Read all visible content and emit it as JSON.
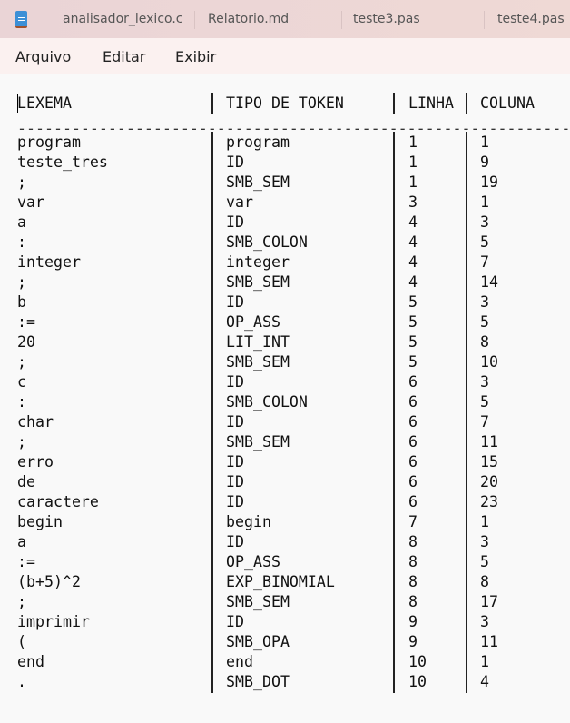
{
  "tabs": [
    {
      "label": "analisador_lexico.c"
    },
    {
      "label": "Relatorio.md"
    },
    {
      "label": "teste3.pas"
    },
    {
      "label": "teste4.pas"
    }
  ],
  "menu": {
    "file": "Arquivo",
    "edit": "Editar",
    "view": "Exibir"
  },
  "table": {
    "headers": [
      "LEXEMA",
      "TIPO DE TOKEN",
      "LINHA",
      "COLUNA"
    ],
    "separator": "--------------------------------------------------------------",
    "rows": [
      [
        "program",
        "program",
        "1",
        "1"
      ],
      [
        "teste_tres",
        "ID",
        "1",
        "9"
      ],
      [
        ";",
        "SMB_SEM",
        "1",
        "19"
      ],
      [
        "var",
        "var",
        "3",
        "1"
      ],
      [
        "a",
        "ID",
        "4",
        "3"
      ],
      [
        ":",
        "SMB_COLON",
        "4",
        "5"
      ],
      [
        "integer",
        "integer",
        "4",
        "7"
      ],
      [
        ";",
        "SMB_SEM",
        "4",
        "14"
      ],
      [
        "b",
        "ID",
        "5",
        "3"
      ],
      [
        ":=",
        "OP_ASS",
        "5",
        "5"
      ],
      [
        "20",
        "LIT_INT",
        "5",
        "8"
      ],
      [
        ";",
        "SMB_SEM",
        "5",
        "10"
      ],
      [
        "c",
        "ID",
        "6",
        "3"
      ],
      [
        ":",
        "SMB_COLON",
        "6",
        "5"
      ],
      [
        "char",
        "ID",
        "6",
        "7"
      ],
      [
        ";",
        "SMB_SEM",
        "6",
        "11"
      ],
      [
        "erro",
        "ID",
        "6",
        "15"
      ],
      [
        "de",
        "ID",
        "6",
        "20"
      ],
      [
        "caractere",
        "ID",
        "6",
        "23"
      ],
      [
        "begin",
        "begin",
        "7",
        "1"
      ],
      [
        "a",
        "ID",
        "8",
        "3"
      ],
      [
        ":=",
        "OP_ASS",
        "8",
        "5"
      ],
      [
        "(b+5)^2",
        "EXP_BINOMIAL",
        "8",
        "8"
      ],
      [
        ";",
        "SMB_SEM",
        "8",
        "17"
      ],
      [
        "imprimir",
        "ID",
        "9",
        "3"
      ],
      [
        "(",
        "SMB_OPA",
        "9",
        "11"
      ],
      [
        "end",
        "end",
        "10",
        "1"
      ],
      [
        ".",
        "SMB_DOT",
        "10",
        "4"
      ]
    ]
  }
}
